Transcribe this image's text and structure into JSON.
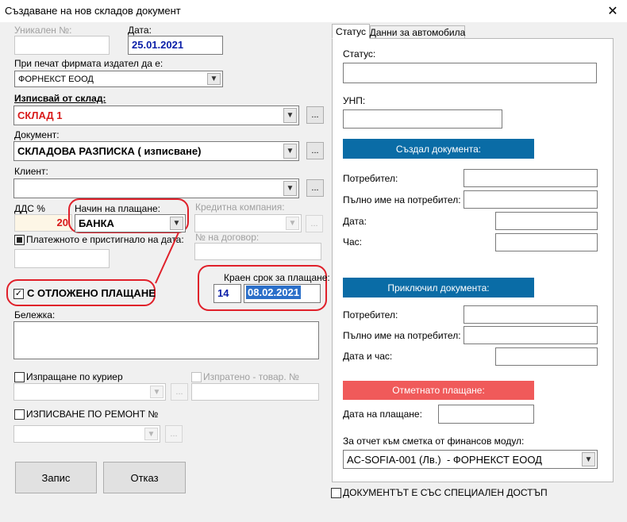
{
  "window": {
    "title": "Създаване на нов складов документ",
    "close_glyph": "✕"
  },
  "left": {
    "unique_no": {
      "label": "Уникален №:",
      "value": ""
    },
    "date": {
      "label": "Дата:",
      "value": "25.01.2021"
    },
    "print_company": {
      "label": "При печат фирмата издател да е:",
      "value": "ФОРНЕКСТ ЕООД"
    },
    "warehouse": {
      "label": "Изписвай от склад:",
      "value": "СКЛАД 1"
    },
    "document": {
      "label": "Документ:",
      "value": "СКЛАДОВА РАЗПИСКА ( изписване)"
    },
    "client": {
      "label": "Клиент:",
      "value": ""
    },
    "vat": {
      "label": "ДДС %",
      "value": "20"
    },
    "payment_method": {
      "label": "Начин на плащане:",
      "value": "БАНКА"
    },
    "credit_company": {
      "label": "Кредитна компания:",
      "value": ""
    },
    "payment_received": {
      "label": "Платежното е пристигнало на дата:",
      "value": ""
    },
    "contract_no": {
      "label": "№ на договор:",
      "value": ""
    },
    "deferred_payment": {
      "label": "С ОТЛОЖЕНО ПЛАЩАНЕ",
      "checked": true
    },
    "payment_deadline": {
      "label": "Краен срок за плащане:",
      "days": "14",
      "date": "08.02.2021"
    },
    "note": {
      "label": "Бележка:",
      "value": ""
    },
    "courier": {
      "label": "Изпращане по куриер",
      "value": ""
    },
    "sent_goods": {
      "label": "Изпратено - товар. №",
      "value": ""
    },
    "repair": {
      "label": "ИЗПИСВАНЕ ПО РЕМОНТ №",
      "value": ""
    },
    "dots_label": "...",
    "save_label": "Запис",
    "cancel_label": "Отказ"
  },
  "tabs": [
    {
      "label": "Статус",
      "active": true
    },
    {
      "label": "Данни за автомобила",
      "active": false
    }
  ],
  "status_panel": {
    "status_label": "Статус:",
    "status_value": "",
    "unp_label": "УНП:",
    "unp_value": "",
    "created_header": "Създал документа:",
    "created": {
      "user_label": "Потребител:",
      "fullname_label": "Пълно име на потребител:",
      "date_label": "Дата:",
      "time_label": "Час:"
    },
    "closed_header": "Приключил документа:",
    "closed": {
      "user_label": "Потребител:",
      "fullname_label": "Пълно име на потребител:",
      "datetime_label": "Дата и час:"
    },
    "cancelled_header": "Отметнато плащане:",
    "payment_date_label": "Дата на плащане:",
    "finance_label": "За отчет към сметка от финансов модул:",
    "finance_value": "AC-SOFIA-001 (Лв.)  - ФОРНЕКСТ ЕООД"
  },
  "special_access": {
    "label": "ДОКУМЕНТЪТ Е СЪС СПЕЦИАЛЕН ДОСТЪП",
    "checked": false
  },
  "colors": {
    "header_blue": "#0a6ca6",
    "header_red": "#f05a5a",
    "annotation_red": "#e0202a",
    "value_red": "#d81a1a",
    "value_blue": "#0a1fa8"
  }
}
